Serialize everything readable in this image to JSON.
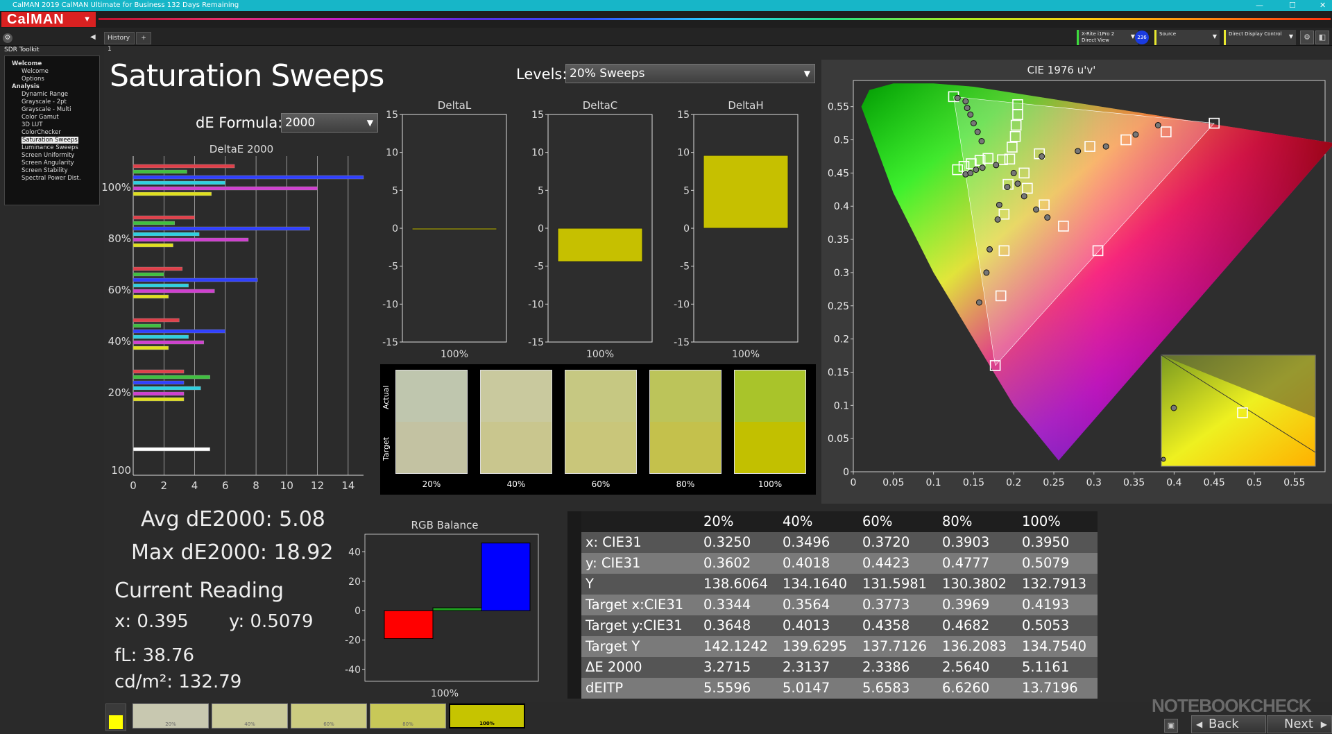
{
  "app": {
    "title_bar": "CalMAN 2019 CalMAN Ultimate for Business 132 Days Remaining",
    "logo": "CalMAN",
    "window_controls": [
      "—",
      "☐",
      "✕"
    ]
  },
  "tabs": [
    {
      "label": "History 1"
    }
  ],
  "devices": {
    "meter": "X-Rite i1Pro 2\nDirect View",
    "meter_badge": "236",
    "source": "Source",
    "display": "Direct Display Control"
  },
  "sidebar": {
    "title": "SDR Toolkit",
    "items": [
      {
        "label": "Welcome",
        "level": 0,
        "bold": true
      },
      {
        "label": "Welcome",
        "level": 1
      },
      {
        "label": "Options",
        "level": 1
      },
      {
        "label": "Analysis",
        "level": 0,
        "bold": true
      },
      {
        "label": "Dynamic Range",
        "level": 1
      },
      {
        "label": "Grayscale - 2pt",
        "level": 1
      },
      {
        "label": "Grayscale - Multi",
        "level": 1
      },
      {
        "label": "Color Gamut",
        "level": 1
      },
      {
        "label": "3D LUT",
        "level": 1
      },
      {
        "label": "ColorChecker",
        "level": 1
      },
      {
        "label": "Saturation Sweeps",
        "level": 1,
        "selected": true
      },
      {
        "label": "Luminance Sweeps",
        "level": 1
      },
      {
        "label": "Screen Uniformity",
        "level": 1
      },
      {
        "label": "Screen Angularity",
        "level": 1
      },
      {
        "label": "Screen Stability",
        "level": 1
      },
      {
        "label": "Spectral Power Dist.",
        "level": 1
      }
    ]
  },
  "page": {
    "title": "Saturation Sweeps",
    "levels_label": "Levels:",
    "levels_value": "20% Sweeps",
    "de_formula_label": "dE Formula:",
    "de_formula_value": "2000"
  },
  "chart_data": [
    {
      "type": "bar",
      "title": "DeltaE 2000",
      "orientation": "horizontal",
      "categories": [
        "100%",
        "80%",
        "60%",
        "40%",
        "20%",
        "100"
      ],
      "xlim": [
        0,
        15
      ],
      "xticks": [
        0,
        2,
        4,
        6,
        8,
        10,
        12,
        14
      ],
      "series": [
        {
          "color": "#e0404a",
          "values": [
            6.6,
            4.0,
            3.2,
            3.0,
            3.3,
            5.0
          ]
        },
        {
          "color": "#40c040",
          "values": [
            3.5,
            2.7,
            2.0,
            1.8,
            5.0,
            5.0
          ]
        },
        {
          "color": "#3040ff",
          "values": [
            18.92,
            11.5,
            8.1,
            6.0,
            3.3,
            5.0
          ]
        },
        {
          "color": "#30d0e0",
          "values": [
            6.0,
            4.3,
            3.6,
            3.6,
            4.4,
            5.0
          ]
        },
        {
          "color": "#d040d0",
          "values": [
            12.0,
            7.5,
            5.3,
            4.6,
            3.3,
            5.0
          ]
        },
        {
          "color": "#e0e020",
          "values": [
            5.1,
            2.6,
            2.3,
            2.3,
            3.3,
            5.0
          ]
        }
      ]
    },
    {
      "type": "bar",
      "title": "DeltaL",
      "categories": [
        "100%"
      ],
      "values": [
        0.0
      ],
      "ylim": [
        -15,
        15
      ],
      "yticks": [
        15,
        10,
        5,
        0,
        -5,
        -10,
        -15
      ]
    },
    {
      "type": "bar",
      "title": "DeltaC",
      "categories": [
        "100%"
      ],
      "values": [
        -4.4
      ],
      "ylim": [
        -15,
        15
      ],
      "yticks": [
        15,
        10,
        5,
        0,
        -5,
        -10,
        -15
      ]
    },
    {
      "type": "bar",
      "title": "DeltaH",
      "categories": [
        "100%"
      ],
      "values": [
        9.6
      ],
      "ylim": [
        -15,
        15
      ],
      "yticks": [
        15,
        10,
        5,
        0,
        -5,
        -10,
        -15
      ]
    },
    {
      "type": "bar",
      "title": "RGB Balance",
      "categories": [
        "100%"
      ],
      "series": [
        {
          "color": "#ff0000",
          "value": -19
        },
        {
          "color": "#20a020",
          "value": 2
        },
        {
          "color": "#0000ff",
          "value": 46
        }
      ],
      "ylim": [
        -48,
        52
      ],
      "yticks": [
        40,
        20,
        0,
        -20,
        -40
      ]
    },
    {
      "type": "scatter",
      "title": "CIE 1976 u'v'",
      "xlim": [
        0,
        0.6
      ],
      "ylim": [
        0,
        0.6
      ],
      "xticks": [
        0,
        0.05,
        0.1,
        0.15,
        0.2,
        0.25,
        0.3,
        0.35,
        0.4,
        0.45,
        0.5,
        0.55
      ],
      "yticks": [
        0,
        0.05,
        0.1,
        0.15,
        0.2,
        0.25,
        0.3,
        0.35,
        0.4,
        0.45,
        0.5,
        0.55
      ],
      "targets": [
        [
          0.125,
          0.565
        ],
        [
          0.205,
          0.553
        ],
        [
          0.205,
          0.538
        ],
        [
          0.203,
          0.522
        ],
        [
          0.202,
          0.505
        ],
        [
          0.198,
          0.489
        ],
        [
          0.13,
          0.455
        ],
        [
          0.138,
          0.46
        ],
        [
          0.147,
          0.464
        ],
        [
          0.158,
          0.469
        ],
        [
          0.168,
          0.472
        ],
        [
          0.195,
          0.471
        ],
        [
          0.213,
          0.45
        ],
        [
          0.193,
          0.433
        ],
        [
          0.232,
          0.479
        ],
        [
          0.295,
          0.49
        ],
        [
          0.34,
          0.5
        ],
        [
          0.39,
          0.512
        ],
        [
          0.45,
          0.525
        ],
        [
          0.217,
          0.427
        ],
        [
          0.238,
          0.402
        ],
        [
          0.262,
          0.37
        ],
        [
          0.305,
          0.333
        ],
        [
          0.188,
          0.388
        ],
        [
          0.188,
          0.333
        ],
        [
          0.184,
          0.265
        ],
        [
          0.177,
          0.16
        ],
        [
          0.186,
          0.47
        ]
      ],
      "actuals": [
        [
          0.13,
          0.563
        ],
        [
          0.14,
          0.558
        ],
        [
          0.142,
          0.548
        ],
        [
          0.146,
          0.538
        ],
        [
          0.15,
          0.525
        ],
        [
          0.155,
          0.512
        ],
        [
          0.16,
          0.498
        ],
        [
          0.14,
          0.448
        ],
        [
          0.146,
          0.45
        ],
        [
          0.153,
          0.455
        ],
        [
          0.161,
          0.458
        ],
        [
          0.178,
          0.462
        ],
        [
          0.2,
          0.45
        ],
        [
          0.205,
          0.434
        ],
        [
          0.213,
          0.415
        ],
        [
          0.228,
          0.395
        ],
        [
          0.242,
          0.383
        ],
        [
          0.235,
          0.475
        ],
        [
          0.28,
          0.483
        ],
        [
          0.315,
          0.49
        ],
        [
          0.352,
          0.508
        ],
        [
          0.38,
          0.522
        ],
        [
          0.192,
          0.429
        ],
        [
          0.182,
          0.402
        ],
        [
          0.18,
          0.38
        ],
        [
          0.17,
          0.335
        ],
        [
          0.166,
          0.3
        ],
        [
          0.157,
          0.255
        ]
      ]
    },
    {
      "type": "table",
      "columns": [
        "",
        "20%",
        "40%",
        "60%",
        "80%",
        "100%"
      ],
      "rows": [
        [
          "x: CIE31",
          "0.3250",
          "0.3496",
          "0.3720",
          "0.3903",
          "0.3950"
        ],
        [
          "y: CIE31",
          "0.3602",
          "0.4018",
          "0.4423",
          "0.4777",
          "0.5079"
        ],
        [
          "Y",
          "138.6064",
          "134.1640",
          "131.5981",
          "130.3802",
          "132.7913"
        ],
        [
          "Target x:CIE31",
          "0.3344",
          "0.3564",
          "0.3773",
          "0.3969",
          "0.4193"
        ],
        [
          "Target y:CIE31",
          "0.3648",
          "0.4013",
          "0.4358",
          "0.4682",
          "0.5053"
        ],
        [
          "Target Y",
          "142.1242",
          "139.6295",
          "137.7126",
          "136.2083",
          "134.7540"
        ],
        [
          "ΔE 2000",
          "3.2715",
          "2.3137",
          "2.3386",
          "2.5640",
          "5.1161"
        ],
        [
          "dEITP",
          "5.5596",
          "5.0147",
          "5.6583",
          "6.6260",
          "13.7196"
        ]
      ]
    }
  ],
  "swatches_panel": {
    "side_actual": "Actual",
    "side_target": "Target",
    "items": [
      {
        "label": "20%",
        "actual": "#bfc6ae",
        "target": "#c3c2a2"
      },
      {
        "label": "40%",
        "actual": "#c9c99e",
        "target": "#c9c68e"
      },
      {
        "label": "60%",
        "actual": "#c6c882",
        "target": "#c9c67a"
      },
      {
        "label": "80%",
        "actual": "#bcc45a",
        "target": "#c4c14c"
      },
      {
        "label": "100%",
        "actual": "#a9c42a",
        "target": "#c2c000"
      }
    ]
  },
  "stats": {
    "avg": "Avg dE2000: 5.08",
    "max": "Max dE2000: 18.92",
    "current_reading": "Current Reading",
    "x": "x: 0.395",
    "y": "y: 0.5079",
    "fl": "fL: 38.76",
    "cdm2": "cd/m²: 132.79"
  },
  "bottom_swatches": [
    {
      "label": "20%",
      "color": "#c8c8b0"
    },
    {
      "label": "40%",
      "color": "#cbcb9b"
    },
    {
      "label": "60%",
      "color": "#cbcb80"
    },
    {
      "label": "80%",
      "color": "#c8c858"
    },
    {
      "label": "100%",
      "color": "#c6c400"
    }
  ],
  "nav": {
    "back": "Back",
    "next": "Next"
  },
  "watermark": "NOTEBOOKCHECK"
}
